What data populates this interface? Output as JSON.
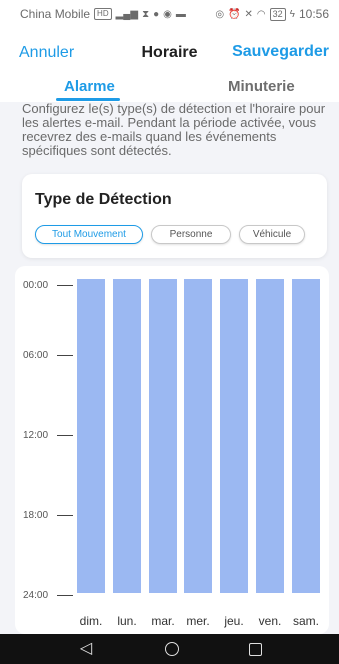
{
  "status_bar": {
    "carrier": "China Mobile",
    "signal_label": "4G",
    "battery": "32",
    "time": "10:56"
  },
  "nav": {
    "cancel": "Annuler",
    "title": "Horaire",
    "save": "Sauvegarder"
  },
  "tabs": [
    {
      "label": "Alarme",
      "active": true
    },
    {
      "label": "Minuterie",
      "active": false
    }
  ],
  "description": "Configurez le(s) type(s) de détection et l'horaire pour les alertes e-mail. Pendant la période activée, vous recevrez des e-mails quand les événements spécifiques sont détectés.",
  "detection": {
    "title": "Type de Détection",
    "chips": [
      {
        "label": "Tout Mouvement",
        "selected": true
      },
      {
        "label": "Personne",
        "selected": false
      },
      {
        "label": "Véhicule",
        "selected": false
      }
    ]
  },
  "schedule": {
    "time_labels": [
      "00:00",
      "06:00",
      "12:00",
      "18:00",
      "24:00"
    ],
    "days": [
      "dim.",
      "lun.",
      "mar.",
      "mer.",
      "jeu.",
      "ven.",
      "sam."
    ],
    "active_color": "#9bb8f2"
  },
  "colors": {
    "accent": "#1e9be6",
    "schedule_fill": "#9bb8f2"
  }
}
